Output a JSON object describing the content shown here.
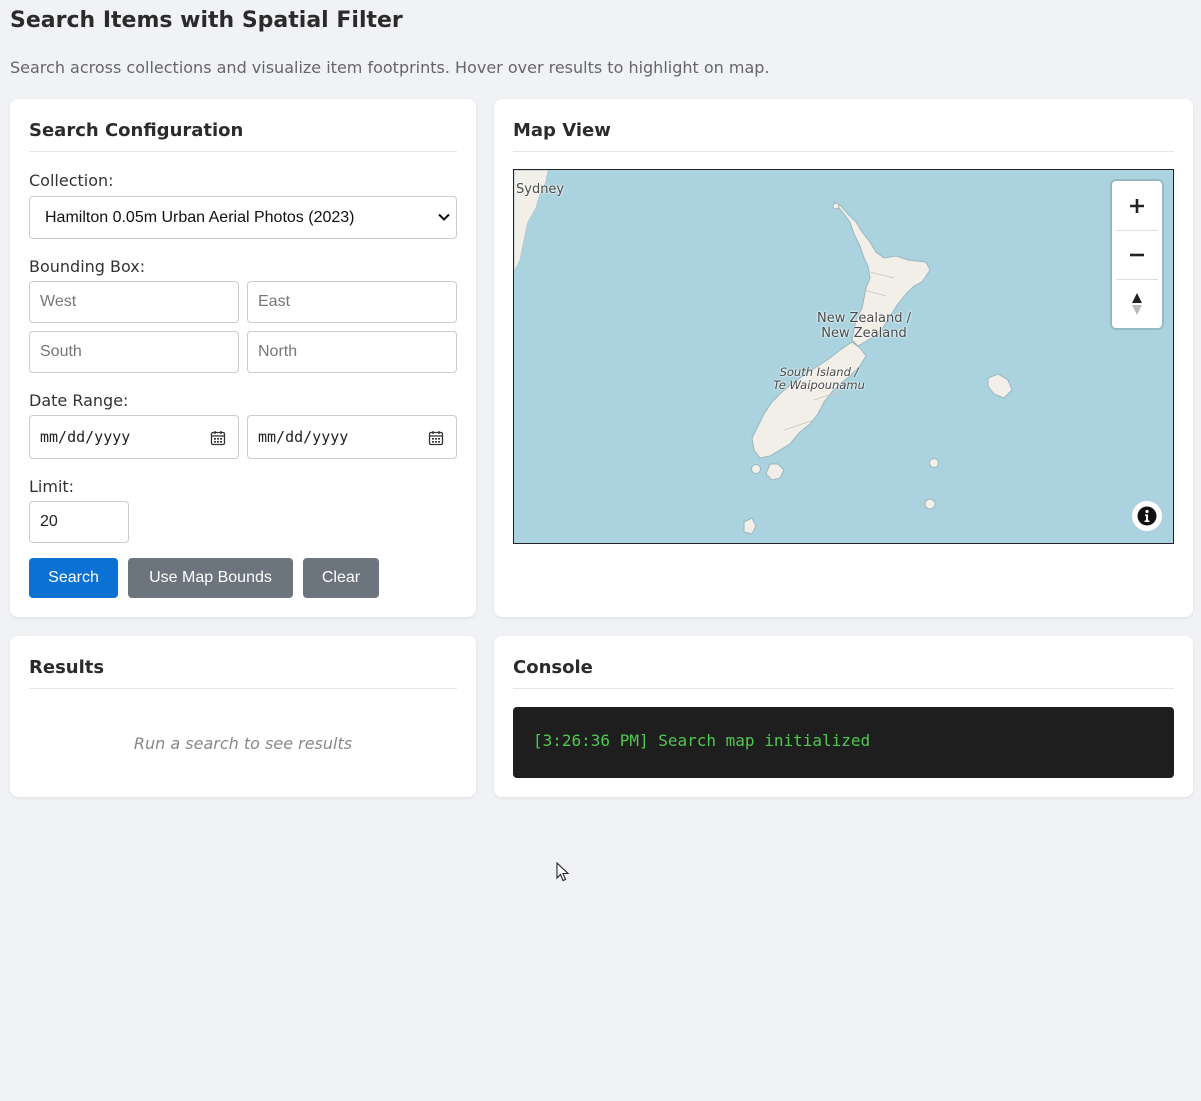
{
  "page": {
    "title": "Search Items with Spatial Filter",
    "subtitle": "Search across collections and visualize item footprints. Hover over results to highlight on map."
  },
  "config": {
    "heading": "Search Configuration",
    "collection_label": "Collection:",
    "collection_value": "Hamilton 0.05m Urban Aerial Photos (2023)",
    "bbox_label": "Bounding Box:",
    "west_placeholder": "West",
    "east_placeholder": "East",
    "south_placeholder": "South",
    "north_placeholder": "North",
    "date_label": "Date Range:",
    "date_start_placeholder": "mm/dd/yyyy",
    "date_end_placeholder": "mm/dd/yyyy",
    "limit_label": "Limit:",
    "limit_value": "20",
    "buttons": {
      "search": "Search",
      "use_map_bounds": "Use Map Bounds",
      "clear": "Clear"
    }
  },
  "map": {
    "heading": "Map View",
    "labels": {
      "sydney": "Sydney",
      "nz_line1": "New Zealand /",
      "nz_line2": "New Zealand",
      "si_line1": "South Island /",
      "si_line2": "Te Waipounamu"
    },
    "controls": {
      "zoom_in": "+",
      "zoom_out": "−"
    },
    "colors": {
      "water": "#aad3df",
      "land": "#f2efe9"
    }
  },
  "results": {
    "heading": "Results",
    "empty_message": "Run a search to see results"
  },
  "console": {
    "heading": "Console",
    "lines": [
      "[3:26:36 PM] Search map initialized"
    ]
  },
  "colors": {
    "primary": "#0b72d3",
    "secondary": "#6c757d",
    "console_bg": "#1e1e1e",
    "console_text": "#4ec94e"
  }
}
